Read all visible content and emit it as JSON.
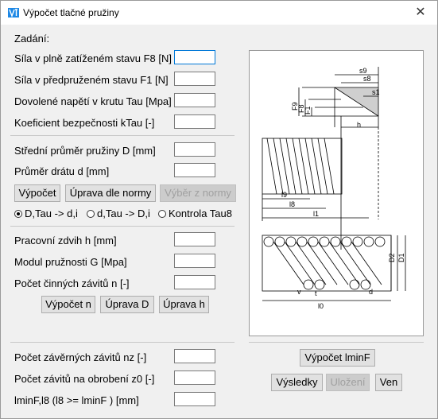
{
  "window": {
    "title": "Výpočet tlačné pružiny",
    "close_glyph": "✕"
  },
  "section_zadani": "Zadání:",
  "inputs_top": [
    {
      "label": "Síla v plně zatíženém stavu F8 [N]",
      "value": ""
    },
    {
      "label": "Síla v předpruženém stavu F1 [N]",
      "value": ""
    },
    {
      "label": "Dovolené napětí v krutu Tau [Mpa]",
      "value": ""
    },
    {
      "label": "Koeficient bezpečnosti kTau [-]",
      "value": ""
    }
  ],
  "inputs_mid": [
    {
      "label": "Střední průměr pružiny D [mm]",
      "value": ""
    },
    {
      "label": "Průměr drátu d [mm]",
      "value": ""
    }
  ],
  "buttons_mid": {
    "vypocet": "Výpočet",
    "uprava_normy": "Úprava dle normy",
    "vyber_normy": "Výběr z normy"
  },
  "radios": [
    {
      "label": "D,Tau -> d,i",
      "checked": true
    },
    {
      "label": "d,Tau -> D,i",
      "checked": false
    },
    {
      "label": "Kontrola Tau8",
      "checked": false
    }
  ],
  "inputs_work": [
    {
      "label": "Pracovní zdvih h [mm]",
      "value": ""
    },
    {
      "label": "Modul pružnosti G [Mpa]",
      "value": ""
    },
    {
      "label": "Počet činných závitů n [-]",
      "value": ""
    }
  ],
  "buttons_work": {
    "vypocet_n": "Výpočet n",
    "uprava_d": "Úprava D",
    "uprava_h": "Úprava h"
  },
  "inputs_bottom": [
    {
      "label": "Počet závěrných závitů nz [-]",
      "value": ""
    },
    {
      "label": "Počet závitů na obrobení z0 [-]",
      "value": ""
    },
    {
      "label": "lminF,l8 (l8 >= lminF ) [mm]",
      "value": ""
    }
  ],
  "buttons_bottom": {
    "vypocet_lminf": "Výpočet lminF",
    "vysledky": "Výsledky",
    "ulozeni": "Uložení",
    "ven": "Ven"
  },
  "diagram_labels": {
    "s9": "s9",
    "s8": "s8",
    "s1": "s1",
    "F9": "F9",
    "F8": "F8",
    "F1": "F1",
    "h": "h",
    "l9": "l9",
    "l8": "l8",
    "l1": "l1",
    "D2": "D2",
    "D1": "D1",
    "v": "v",
    "t": "t",
    "d": "d",
    "l0": "l0"
  },
  "colors": {
    "accent": "#0078d7",
    "background": "#f0f0f0",
    "disabled_text": "#a0a0a0"
  }
}
